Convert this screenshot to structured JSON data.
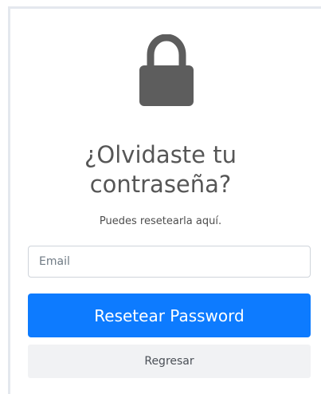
{
  "screen": {
    "icon": "lock-icon",
    "title_line_1": "¿Olvidaste tu",
    "title_line_2": "contraseña?",
    "subtitle": "Puedes resetearla aquí.",
    "email": {
      "placeholder": "Email",
      "value": ""
    },
    "reset_button_label": "Resetear Password",
    "back_button_label": "Regresar"
  },
  "colors": {
    "primary": "#0d7bff",
    "secondary_button": "#f1f2f4",
    "title": "#565656",
    "icon": "#5d5d5d",
    "border": "#cfd4da"
  }
}
